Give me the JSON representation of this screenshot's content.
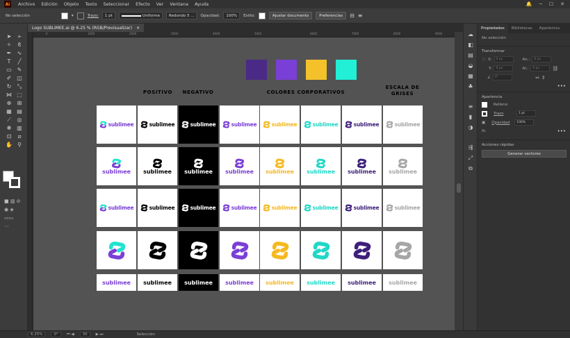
{
  "menu": {
    "logo": "Ai",
    "items": [
      "Archivo",
      "Edición",
      "Objeto",
      "Texto",
      "Seleccionar",
      "Efecto",
      "Ver",
      "Ventana",
      "Ayuda"
    ]
  },
  "control": {
    "selection": "No selección",
    "stroke_label": "Trazo:",
    "stroke_weight": "1 pt",
    "profile": "Uniforme",
    "brush": "Redondo 5 ...",
    "opacity_label": "Opacidad:",
    "opacity": "100%",
    "style_label": "Estilo:",
    "adjust_doc": "Ajustar documento",
    "prefs": "Preferencias"
  },
  "doc_tab": {
    "title": "Logo SUBLIMEE.ai @ 6.25 % (RGB/Previsualizar)",
    "close": "×"
  },
  "ruler": [
    "0",
    "1000",
    "2000",
    "3000",
    "4000",
    "5000",
    "6000",
    "7000",
    "8000",
    "9000"
  ],
  "artboard": {
    "headers": {
      "positivo": "POSITIVO",
      "negativo": "NEGATIVO",
      "corporativos": "COLORES CORPORATIVOS",
      "grises": "ESCALA DE GRISES"
    },
    "brand_word": "sublimee",
    "swatches": [
      "#4a2a86",
      "#7a3fd6",
      "#f5c12a",
      "#21efd6"
    ],
    "columns": [
      {
        "text": "#7a3fd6",
        "mark": "#21e3cf",
        "mark2": "#7a3fd6",
        "bg": "#ffffff"
      },
      {
        "text": "#000000",
        "mark": "#000000",
        "mark2": "#000000",
        "bg": "#ffffff"
      },
      {
        "text": "#ffffff",
        "mark": "#ffffff",
        "mark2": "#ffffff",
        "bg": "#000000"
      },
      {
        "text": "#7a3fd6",
        "mark": "#7a3fd6",
        "mark2": "#7a3fd6",
        "bg": "#ffffff"
      },
      {
        "text": "#f5b920",
        "mark": "#f5b920",
        "mark2": "#f5b920",
        "bg": "#ffffff"
      },
      {
        "text": "#21d7c6",
        "mark": "#21d7c6",
        "mark2": "#21d7c6",
        "bg": "#ffffff"
      },
      {
        "text": "#3d1f7a",
        "mark": "#3d1f7a",
        "mark2": "#3d1f7a",
        "bg": "#ffffff"
      },
      {
        "text": "#a6a6a6",
        "mark": "#a6a6a6",
        "mark2": "#a6a6a6",
        "bg": "#ffffff"
      }
    ]
  },
  "panel": {
    "tabs": [
      "Propiedades",
      "Bibliotecas",
      "Apariencia"
    ],
    "selection": "No selección",
    "transform_title": "Transformar",
    "x_label": "X:",
    "y_label": "Y:",
    "w_label": "An.:",
    "h_label": "Al.:",
    "x_val": "0 px",
    "y_val": "0 px",
    "w_val": "0 px",
    "h_val": "0 px",
    "angle_val": "0°",
    "appearance_title": "Apariencia",
    "fill_label": "Relleno",
    "stroke_label": "Trazo",
    "stroke_val": "1 pt",
    "opacity_label": "Opacidad",
    "opacity_val": "100%",
    "fx": "fx.",
    "quick_actions": "Acciones rápidas",
    "vectorize": "Generar vectores"
  },
  "status": {
    "zoom": "6.25%",
    "angle": "0°",
    "artboard": "30",
    "tool": "Selección"
  }
}
